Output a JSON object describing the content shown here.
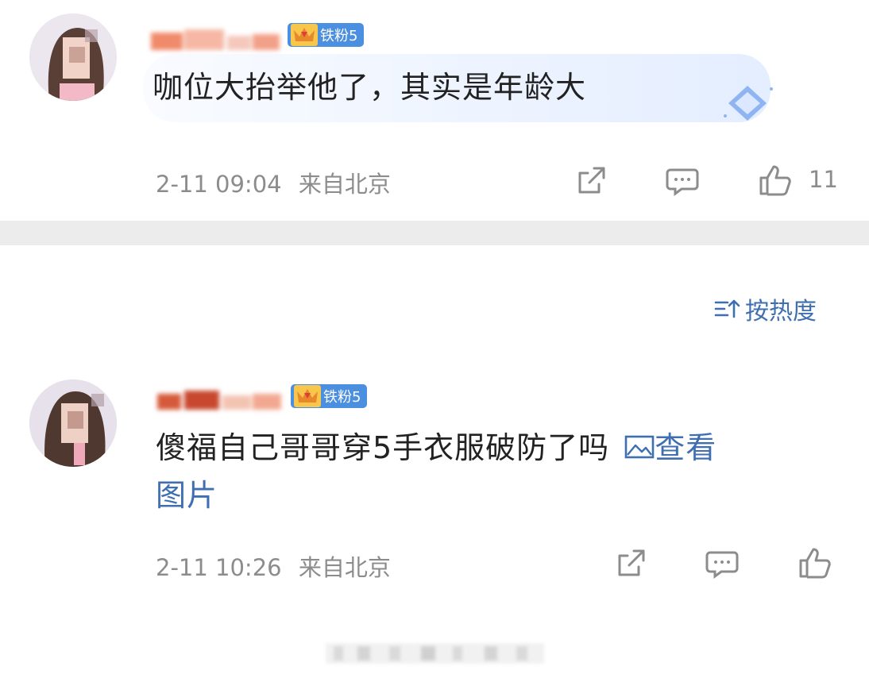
{
  "comments": [
    {
      "badge": "铁粉5",
      "text": "咖位大抬举他了，其实是年龄大",
      "time": "2-11 09:04",
      "location": "来自北京",
      "likes": "11",
      "icons": [
        "share-icon",
        "comment-icon",
        "like-icon"
      ]
    },
    {
      "badge": "铁粉5",
      "text_line1": "傻福自己哥哥穿5手衣服破防了吗",
      "link_inline": "查看",
      "link_line2": "图片",
      "time": "2-11 10:26",
      "location": "来自北京",
      "icons": [
        "share-icon",
        "comment-icon",
        "like-icon"
      ]
    }
  ],
  "sort": {
    "label": "按热度",
    "icon": "sort-icon"
  },
  "colors": {
    "link": "#3f6fb0",
    "badge": "#4b8fe0",
    "divider": "#ececec",
    "meta": "#8c8c8c"
  }
}
